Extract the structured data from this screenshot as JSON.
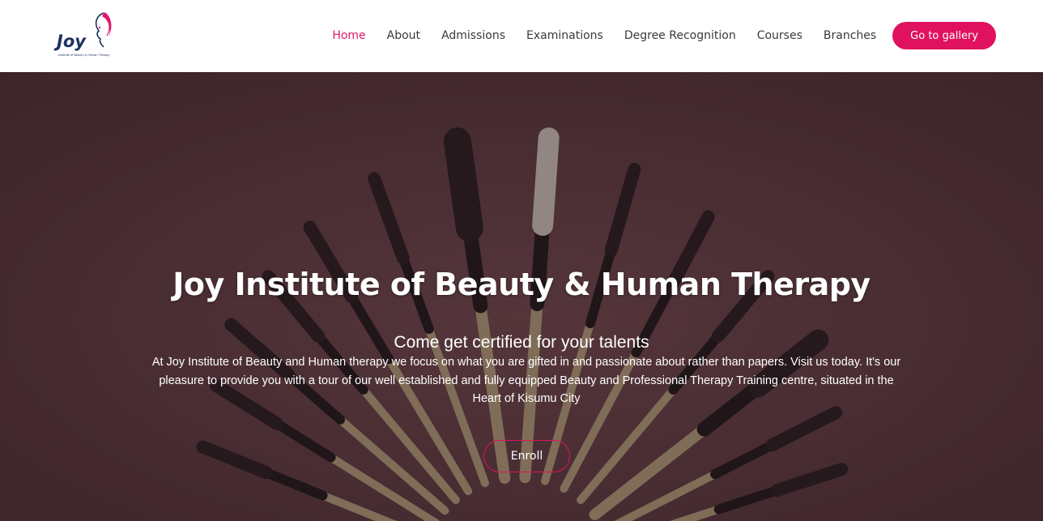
{
  "header": {
    "logo": {
      "brand_text": "Joy",
      "tagline": "Institute of Beauty & Human Therapy",
      "brand_color": "#1d3160",
      "accent_color": "#e0186c"
    },
    "nav": [
      {
        "label": "Home",
        "active": true
      },
      {
        "label": "About",
        "active": false
      },
      {
        "label": "Admissions",
        "active": false
      },
      {
        "label": "Examinations",
        "active": false
      },
      {
        "label": "Degree Recognition",
        "active": false
      },
      {
        "label": "Courses",
        "active": false
      },
      {
        "label": "Branches",
        "active": false
      }
    ],
    "cta_label": "Go to gallery"
  },
  "hero": {
    "title": "Joy Institute of Beauty & Human Therapy",
    "subtitle": "Come get certified for your talents",
    "body": "At Joy Institute of Beauty and Human therapy we focus on what you are gifted in and passionate about rather than papers. Visit us today. It's our pleasure to provide you with a tour of our well established and fully equipped Beauty and Professional Therapy Training centre, situated in the Heart of Kisumu City",
    "enroll_label": "Enroll",
    "background_image": "makeup-brushes-photo"
  },
  "colors": {
    "accent": "#e0125f",
    "nav_text": "#3a3a3a",
    "hero_background": "#5a3a3f"
  }
}
